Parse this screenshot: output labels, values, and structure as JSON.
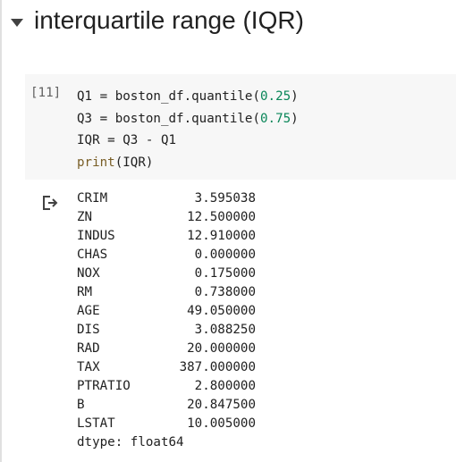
{
  "section": {
    "title": "interquartile range (IQR)",
    "caret_icon": "caret-down-icon"
  },
  "cell": {
    "execution_count": "[11]",
    "code_lines": [
      {
        "pre": "Q1 = boston_df.quantile(",
        "num": "0.25",
        "post": ")"
      },
      {
        "pre": "Q3 = boston_df.quantile(",
        "num": "0.75",
        "post": ")"
      },
      {
        "pre": "IQR = Q3 - Q1",
        "num": "",
        "post": ""
      },
      {
        "fn": "print",
        "pre": "(IQR)",
        "num": "",
        "post": ""
      }
    ]
  },
  "output": {
    "icon": "output-arrow-icon",
    "rows": [
      {
        "name": "CRIM",
        "value": "3.595038"
      },
      {
        "name": "ZN",
        "value": "12.500000"
      },
      {
        "name": "INDUS",
        "value": "12.910000"
      },
      {
        "name": "CHAS",
        "value": "0.000000"
      },
      {
        "name": "NOX",
        "value": "0.175000"
      },
      {
        "name": "RM",
        "value": "0.738000"
      },
      {
        "name": "AGE",
        "value": "49.050000"
      },
      {
        "name": "DIS",
        "value": "3.088250"
      },
      {
        "name": "RAD",
        "value": "20.000000"
      },
      {
        "name": "TAX",
        "value": "387.000000"
      },
      {
        "name": "PTRATIO",
        "value": "2.800000"
      },
      {
        "name": "B",
        "value": "20.847500"
      },
      {
        "name": "LSTAT",
        "value": "10.005000"
      }
    ],
    "dtype": "dtype: float64"
  }
}
